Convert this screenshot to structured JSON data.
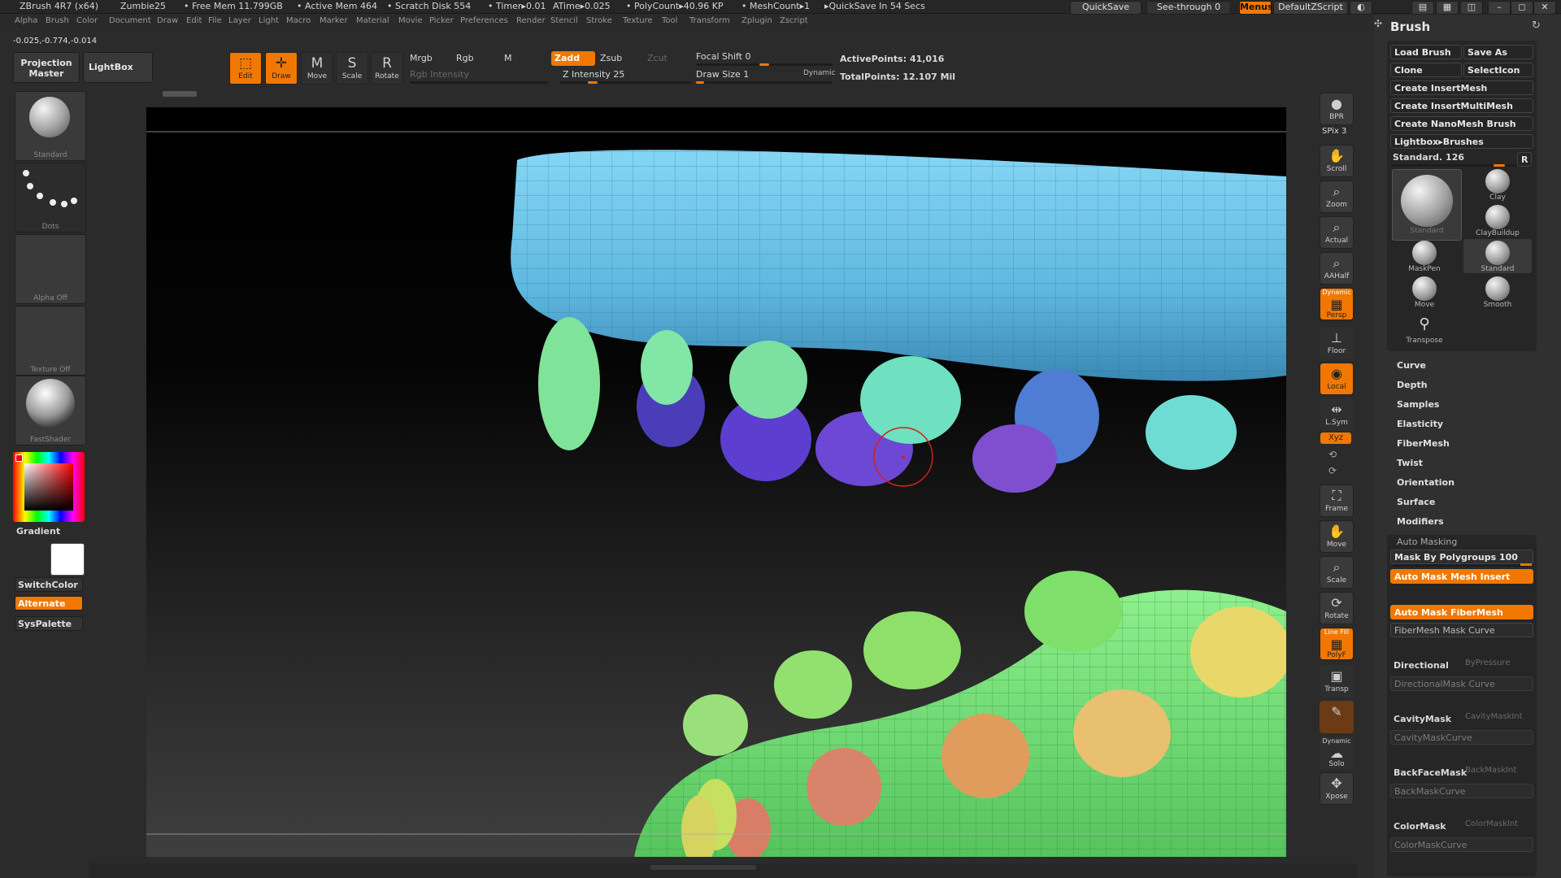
{
  "titlebar": {
    "app": "ZBrush 4R7 (x64)",
    "doc": "Zumbie25",
    "free_mem": "• Free Mem 11.799GB",
    "active_mem": "• Active Mem 464",
    "scratch": "• Scratch Disk 554",
    "timer": "• Timer▸0.01",
    "atime": "ATime▸0.025",
    "polycount": "• PolyCount▸40.96 KP",
    "meshcount": "• MeshCount▸1",
    "quicksave_in": "▸QuickSave In 54 Secs",
    "quicksave_btn": "QuickSave",
    "seethrough": "See-through   0",
    "menus_btn": "Menus",
    "script_btn": "DefaultZScript"
  },
  "menus": [
    "Alpha",
    "Brush",
    "Color",
    "Document",
    "Draw",
    "Edit",
    "File",
    "Layer",
    "Light",
    "Macro",
    "Marker",
    "Material",
    "Movie",
    "Picker",
    "Preferences",
    "Render",
    "Stencil",
    "Stroke",
    "Texture",
    "Tool",
    "Transform",
    "Zplugin",
    "Zscript"
  ],
  "coords": "-0.025,-0.774,-0.014",
  "left": {
    "projection_master": "Projection\nMaster",
    "lightbox": "LightBox",
    "brush_cap": "Standard",
    "stroke_cap": "Dots",
    "alpha_cap": "Alpha Off",
    "texture_cap": "Texture Off",
    "material_cap": "FastShader",
    "gradient": "Gradient",
    "switchcolor": "SwitchColor",
    "alternate": "Alternate",
    "syspalette": "SysPalette"
  },
  "shelf": {
    "edit": "Edit",
    "draw": "Draw",
    "move": "Move",
    "scale": "Scale",
    "rotate": "Rotate",
    "mrgb": "Mrgb",
    "rgb": "Rgb",
    "m": "M",
    "rgb_intensity": "Rgb Intensity",
    "zadd": "Zadd",
    "zsub": "Zsub",
    "zcut": "Zcut",
    "z_intensity": "Z Intensity 25",
    "focal_shift": "Focal Shift 0",
    "draw_size": "Draw Size 1",
    "dynamic": "Dynamic",
    "active_points": "ActivePoints: 41,016",
    "total_points": "TotalPoints: 12.107 Mil",
    "z_intensity_value": 25,
    "focal_shift_value": 0,
    "draw_size_value": 1
  },
  "rightshelf": {
    "bpr": "BPR",
    "spix": "SPix 3",
    "scroll": "Scroll",
    "zoom": "Zoom",
    "actual": "Actual",
    "aahalf": "AAHalf",
    "persp": "Persp",
    "dynamic": "Dynamic",
    "floor": "Floor",
    "local": "Local",
    "lsym": "L.Sym",
    "xyz": "Xyz",
    "frame": "Frame",
    "move": "Move",
    "scale": "Scale",
    "rotate": "Rotate",
    "polyf": "PolyF",
    "linefill": "Line Fill",
    "transp": "Transp",
    "solo": "Solo",
    "xpose": "Xpose"
  },
  "brushpanel": {
    "title": "Brush",
    "load_brush": "Load Brush",
    "save_as": "Save As",
    "clone": "Clone",
    "selecticon": "SelectIcon",
    "create_insertmesh": "Create InsertMesh",
    "create_insertmultimesh": "Create InsertMultiMesh",
    "create_nanomesh": "Create NanoMesh Brush",
    "lightbox_brushes": "Lightbox▸Brushes",
    "current": "Standard. 126",
    "r": "R",
    "brushes": [
      "Standard",
      "Clay",
      "ClayBuildup",
      "MaskPen",
      "Standard",
      "Move",
      "Smooth",
      "Transpose"
    ],
    "sections": [
      "Curve",
      "Depth",
      "Samples",
      "Elasticity",
      "FiberMesh",
      "Twist",
      "Orientation",
      "Surface",
      "Modifiers"
    ],
    "auto_masking": "Auto Masking",
    "mask_by_polygroups": "Mask By Polygroups 100",
    "auto_mask_mesh_insert": "Auto Mask Mesh Insert",
    "auto_mask_fibermesh": "Auto Mask FiberMesh",
    "fibermesh_mask_curve": "FiberMesh Mask Curve",
    "directional": "Directional",
    "bypressure": "ByPressure",
    "directional_curve": "DirectionalMask Curve",
    "cavitymask": "CavityMask",
    "cavitymaskint": "CavityMaskInt",
    "cavitymaskcurve": "CavityMaskCurve",
    "backfacemask": "BackFaceMask",
    "backmaskint": "BackMaskInt",
    "backmaskcurve": "BackMaskCurve",
    "colormask": "ColorMask",
    "colormaskint": "ColorMaskInt",
    "colormaskcurve": "ColorMaskCurve"
  },
  "colors": {
    "accent": "#f07800",
    "mesh_blue": "#6ec6ea",
    "mesh_green": "#72e07a",
    "tooth_purple": "#7a5ad8",
    "tooth_teal": "#6fe0c8"
  }
}
